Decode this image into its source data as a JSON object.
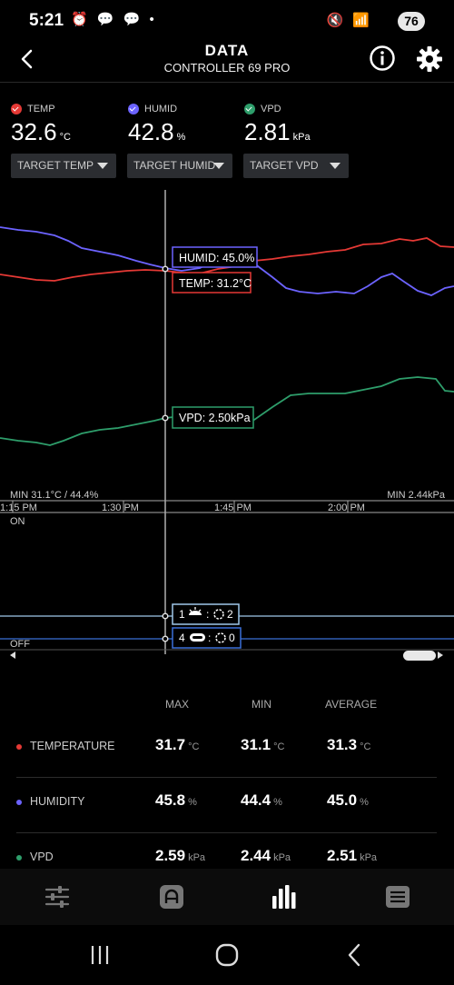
{
  "status_bar": {
    "time": "5:21",
    "left_icons": "⏰ 💬 💬 •",
    "right_icons": "🔇 📶",
    "battery": "76"
  },
  "header": {
    "title": "DATA",
    "subtitle": "CONTROLLER 69 PRO"
  },
  "metrics": [
    {
      "label": "TEMP",
      "value": "32.6",
      "unit": "°C",
      "color": "#e53935",
      "target": "TARGET TEMP"
    },
    {
      "label": "HUMID",
      "value": "42.8",
      "unit": "%",
      "color": "#6c63ff",
      "target": "TARGET HUMID"
    },
    {
      "label": "VPD",
      "value": "2.81",
      "unit": "kPa",
      "color": "#2e9e6b",
      "target": "TARGET VPD"
    }
  ],
  "chart": {
    "x_ticks": [
      "1:15 PM",
      "1:30 PM",
      "1:45 PM",
      "2:00 PM"
    ],
    "min_left": "MIN 31.1°C / 44.4%",
    "min_right": "MIN 2.44kPa",
    "tooltip_humid": "HUMID: 45.0%",
    "tooltip_temp": "TEMP: 31.2°C",
    "tooltip_vpd": "VPD: 2.50kPa",
    "on_label": "ON",
    "off_label": "OFF",
    "device1_index": "1",
    "device1_level": "2",
    "device2_index": "4",
    "device2_level": "0"
  },
  "stats": {
    "headers": [
      "MAX",
      "MIN",
      "AVERAGE"
    ],
    "rows": [
      {
        "name": "TEMPERATURE",
        "color": "#e53935",
        "max": "31.7",
        "min": "31.1",
        "avg": "31.3",
        "unit": "°C"
      },
      {
        "name": "HUMIDITY",
        "color": "#6c63ff",
        "max": "45.8",
        "min": "44.4",
        "avg": "45.0",
        "unit": "%"
      },
      {
        "name": "VPD",
        "color": "#2e9e6b",
        "max": "2.59",
        "min": "2.44",
        "avg": "2.51",
        "unit": "kPa"
      }
    ]
  }
}
